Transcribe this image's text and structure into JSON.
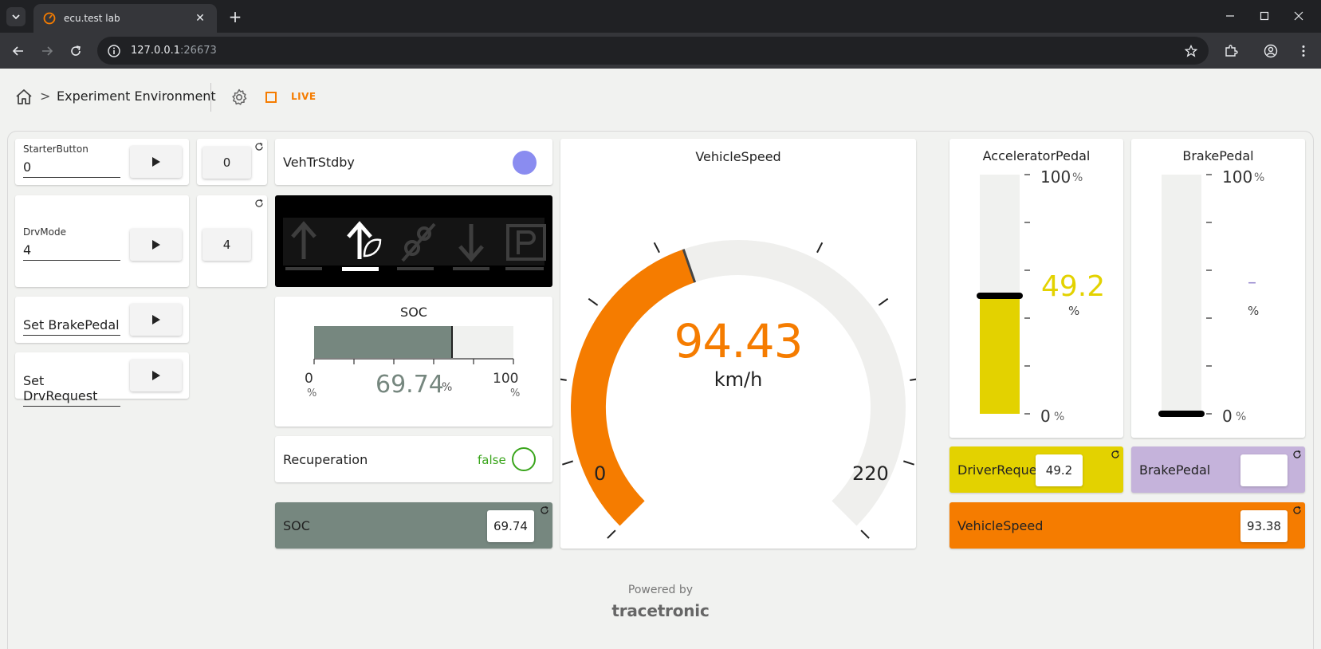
{
  "browser": {
    "tab_title": "ecu.test lab",
    "url_host": "127.0.0.1",
    "url_port": ":26673"
  },
  "app": {
    "breadcrumb_title": "Experiment Environment",
    "live_label": "LIVE",
    "accent": "#f57c00"
  },
  "inputs": {
    "starter": {
      "label": "StarterButton",
      "value": "0",
      "output": "0"
    },
    "drvmode": {
      "label": "DrvMode",
      "value": "4",
      "output": "4"
    },
    "brake": {
      "value": "Set BrakePedal"
    },
    "drvreq": {
      "value": "Set DrvRequest"
    }
  },
  "vehtr": {
    "label": "VehTrStdby",
    "led_color": "#8a8cf0"
  },
  "soc": {
    "title": "SOC",
    "value": "69.74",
    "fraction": 0.6974,
    "min": "0",
    "max": "100",
    "unit": "%",
    "color": "#76877f"
  },
  "recuperation": {
    "label": "Recuperation",
    "value": "false",
    "color": "#3aa51c"
  },
  "soc_box": {
    "label": "SOC",
    "value": "69.74"
  },
  "speed": {
    "title": "VehicleSpeed",
    "value": "94.43",
    "unit": "km/h",
    "min": "0",
    "max": "220",
    "fraction": 0.4292
  },
  "accel": {
    "title": "AcceleratorPedal",
    "max": "100",
    "min": "0",
    "unit": "%",
    "value": "49.2",
    "fraction": 0.492,
    "color": "#e3d200"
  },
  "brakepedal": {
    "title": "BrakePedal",
    "max": "100",
    "min": "0",
    "unit": "%",
    "value": "–",
    "fraction": 0
  },
  "boxes": {
    "driver_request": {
      "label": "DriverRequest",
      "value": "49.2",
      "color": "#e3d200"
    },
    "brake_pedal": {
      "label": "BrakePedal",
      "value": "",
      "color": "#c5b3db"
    },
    "vehicle_speed": {
      "label": "VehicleSpeed",
      "value": "93.38",
      "color": "#f57c00"
    }
  },
  "footer": {
    "powered_by": "Powered by",
    "brand": "tracetronic"
  }
}
